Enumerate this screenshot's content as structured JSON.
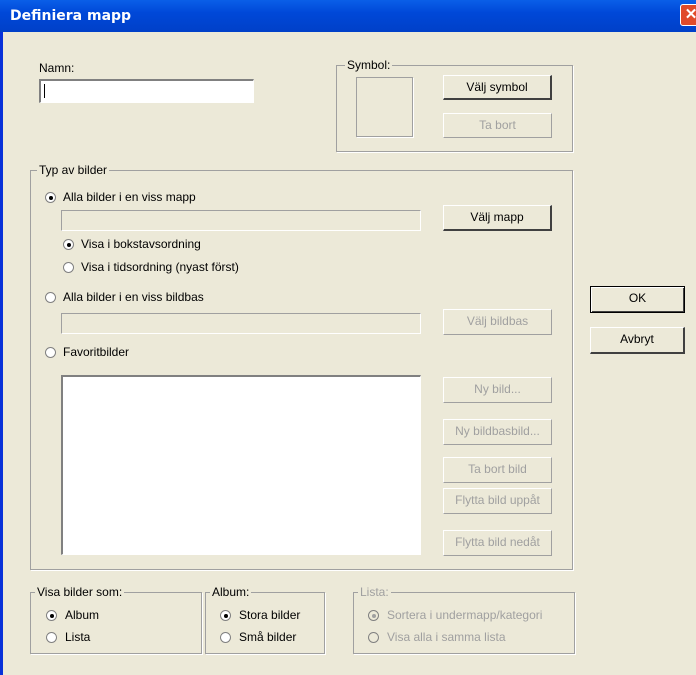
{
  "dialog": {
    "title": "Definiera mapp",
    "close_glyph": "✕"
  },
  "name": {
    "label": "Namn:",
    "value": ""
  },
  "symbol": {
    "legend": "Symbol:",
    "choose_label": "Välj symbol",
    "remove_label": "Ta bort"
  },
  "type": {
    "legend": "Typ av bilder",
    "folder": {
      "label": "Alla bilder i en viss mapp",
      "checked": true,
      "path": "",
      "choose_label": "Välj mapp"
    },
    "sort_alpha": {
      "label": "Visa i bokstavsordning",
      "checked": true
    },
    "sort_time": {
      "label": "Visa i tidsordning (nyast först)",
      "checked": false
    },
    "database": {
      "label": "Alla bilder i en viss bildbas",
      "checked": false,
      "path": "",
      "choose_label": "Välj bildbas"
    },
    "favorites": {
      "label": "Favoritbilder",
      "checked": false
    },
    "fav_buttons": {
      "new": "Ny bild...",
      "new_db": "Ny bildbasbild...",
      "remove": "Ta bort bild",
      "up": "Flytta bild uppåt",
      "down": "Flytta bild nedåt"
    }
  },
  "actions": {
    "ok": "OK",
    "cancel": "Avbryt"
  },
  "show_as": {
    "legend": "Visa bilder som:",
    "album": "Album",
    "list": "Lista",
    "selected": "Album"
  },
  "album": {
    "legend": "Album:",
    "large": "Stora bilder",
    "small": "Små bilder",
    "selected": "Stora bilder"
  },
  "lista": {
    "legend": "Lista:",
    "sort_sub": "Sortera i undermapp/kategori",
    "all_same": "Visa alla i samma lista",
    "selected": "Sortera i undermapp/kategori"
  }
}
